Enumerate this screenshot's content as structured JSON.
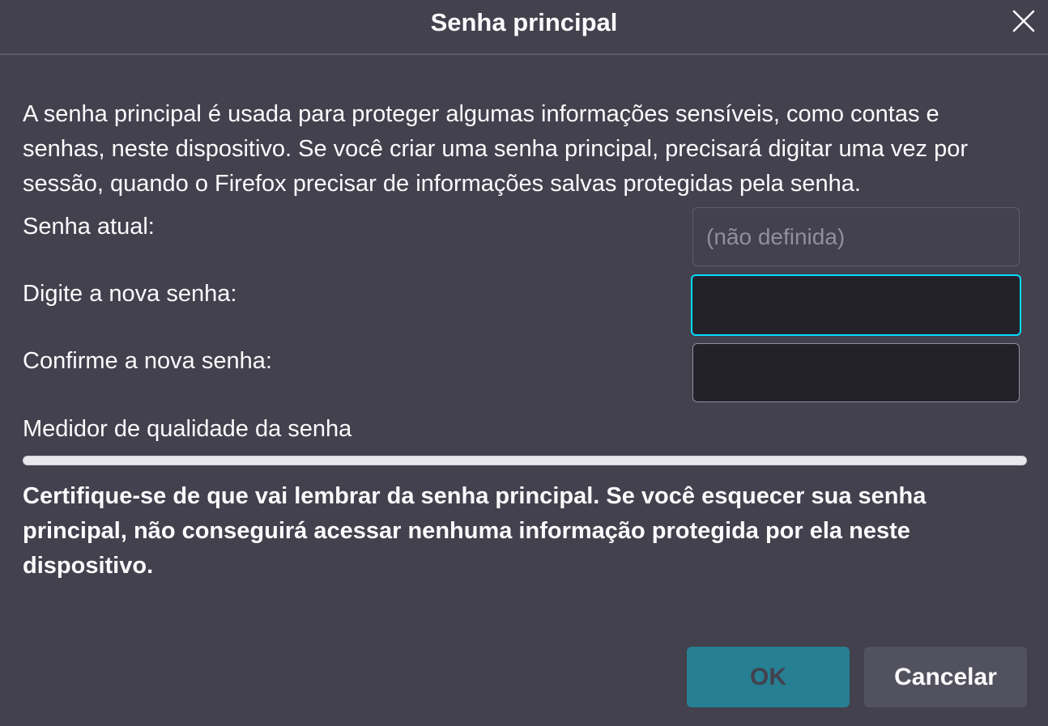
{
  "dialog": {
    "title": "Senha principal",
    "close_icon": "close-icon",
    "intro_text": "A senha principal é usada para proteger algumas informações sensíveis, como contas e senhas, neste dispositivo. Se você criar uma senha principal, precisará digitar uma vez por sessão, quando o Firefox precisar de informações salvas protegidas pela senha.",
    "current_password": {
      "label": "Senha atual:",
      "placeholder": "(não definida)",
      "value": ""
    },
    "new_password": {
      "label": "Digite a nova senha:",
      "value": ""
    },
    "confirm_password": {
      "label": "Confirme a nova senha:",
      "value": ""
    },
    "quality_meter": {
      "label": "Medidor de qualidade da senha",
      "value": 0
    },
    "warning_text": "Certifique-se de que vai lembrar da senha principal. Se você esquecer sua senha principal, não conseguirá acessar nenhuma informação protegida por ela neste dispositivo.",
    "buttons": {
      "ok_label": "OK",
      "cancel_label": "Cancelar"
    },
    "colors": {
      "background": "#42414d",
      "focus_ring": "#00ddff",
      "primary_button": "#267f92",
      "secondary_button": "#52515e"
    }
  }
}
